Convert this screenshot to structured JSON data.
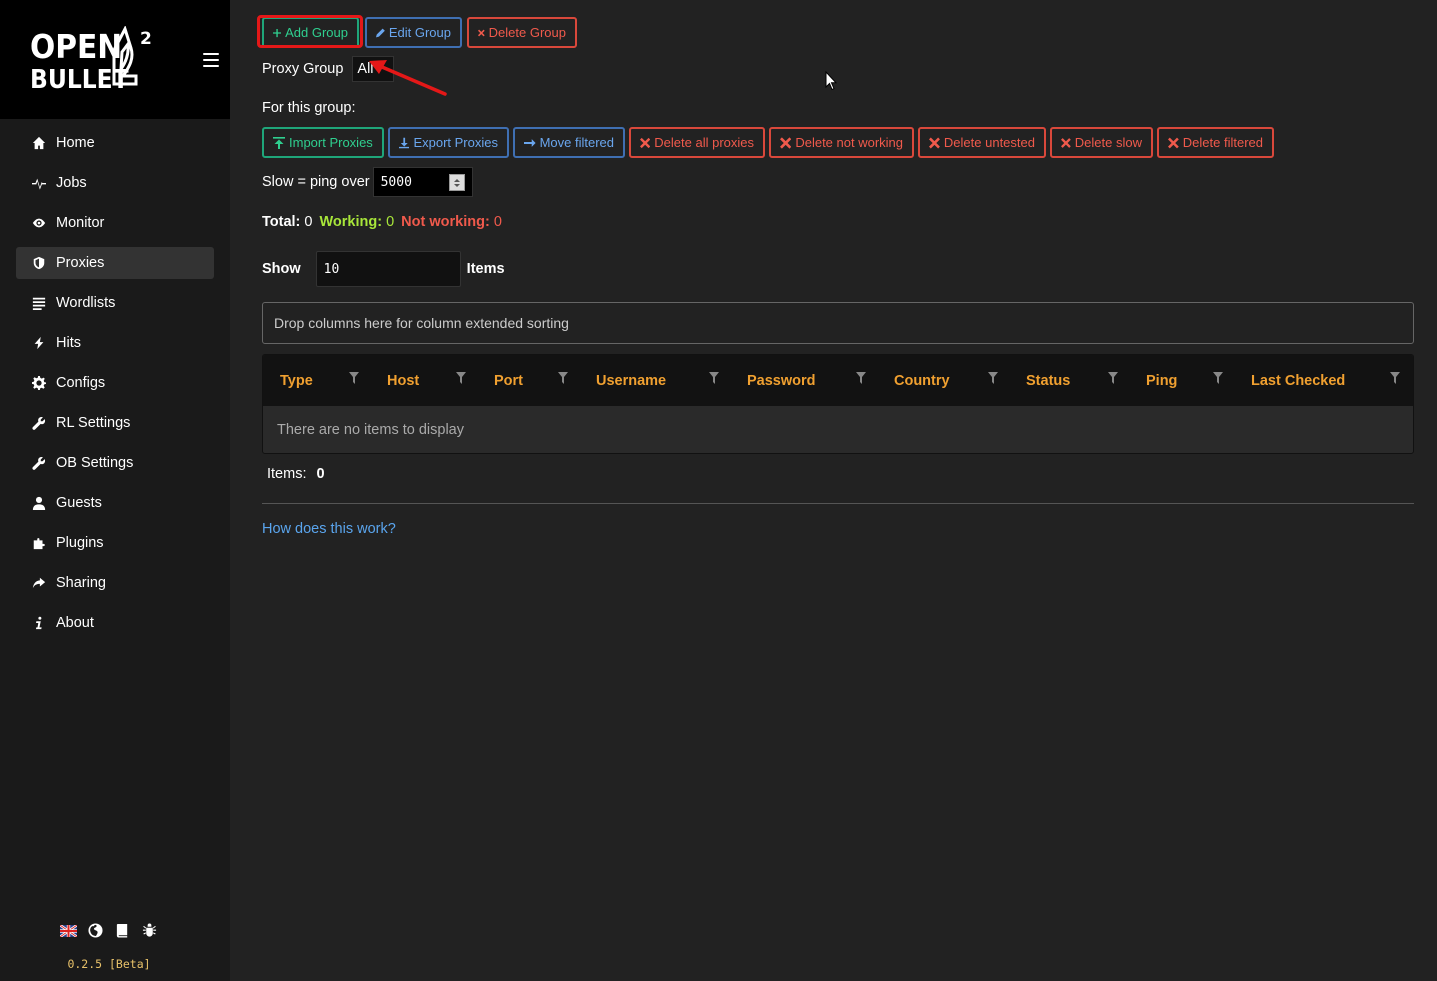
{
  "app": {
    "logo_top": "OPEN",
    "logo_bottom": "BULLET",
    "logo_sup": "2",
    "version": "0.2.5 [Beta]"
  },
  "sidebar": {
    "items": [
      {
        "label": "Home",
        "icon": "home-icon"
      },
      {
        "label": "Jobs",
        "icon": "pulse-icon"
      },
      {
        "label": "Monitor",
        "icon": "eye-icon"
      },
      {
        "label": "Proxies",
        "icon": "shield-icon",
        "active": true
      },
      {
        "label": "Wordlists",
        "icon": "list-icon"
      },
      {
        "label": "Hits",
        "icon": "bolt-icon"
      },
      {
        "label": "Configs",
        "icon": "gear-icon"
      },
      {
        "label": "RL Settings",
        "icon": "wrench-icon"
      },
      {
        "label": "OB Settings",
        "icon": "wrench-icon"
      },
      {
        "label": "Guests",
        "icon": "user-icon"
      },
      {
        "label": "Plugins",
        "icon": "puzzle-icon"
      },
      {
        "label": "Sharing",
        "icon": "share-icon"
      },
      {
        "label": "About",
        "icon": "info-icon"
      }
    ],
    "footer_icons": [
      "uk-flag-icon",
      "globe-icon",
      "book-icon",
      "bug-icon"
    ]
  },
  "toolbar": {
    "add_group": "Add Group",
    "edit_group": "Edit Group",
    "delete_group": "Delete Group"
  },
  "proxy_group": {
    "label": "Proxy Group",
    "selected": "All"
  },
  "for_group_label": "For this group:",
  "actions": {
    "import": "Import Proxies",
    "export": "Export Proxies",
    "move_filtered": "Move filtered",
    "delete_all": "Delete all proxies",
    "delete_not_working": "Delete not working",
    "delete_untested": "Delete untested",
    "delete_slow": "Delete slow",
    "delete_filtered": "Delete filtered"
  },
  "slow": {
    "label": "Slow = ping over",
    "value": "5000"
  },
  "stats": {
    "total_label": "Total:",
    "total": "0",
    "working_label": "Working:",
    "working": "0",
    "not_working_label": "Not working:",
    "not_working": "0"
  },
  "show": {
    "label": "Show",
    "value": "10",
    "suffix": "Items"
  },
  "drop_zone": "Drop columns here for column extended sorting",
  "table": {
    "columns": [
      "Type",
      "Host",
      "Port",
      "Username",
      "Password",
      "Country",
      "Status",
      "Ping",
      "Last Checked"
    ],
    "empty_text": "There are no items to display"
  },
  "items": {
    "label": "Items:",
    "count": "0"
  },
  "help_link": "How does this work?",
  "colors": {
    "accent_orange": "#f0a030",
    "green": "#2fcf8f",
    "blue": "#6aa6ee",
    "red": "#f05a4c",
    "working": "#a8e63a"
  }
}
